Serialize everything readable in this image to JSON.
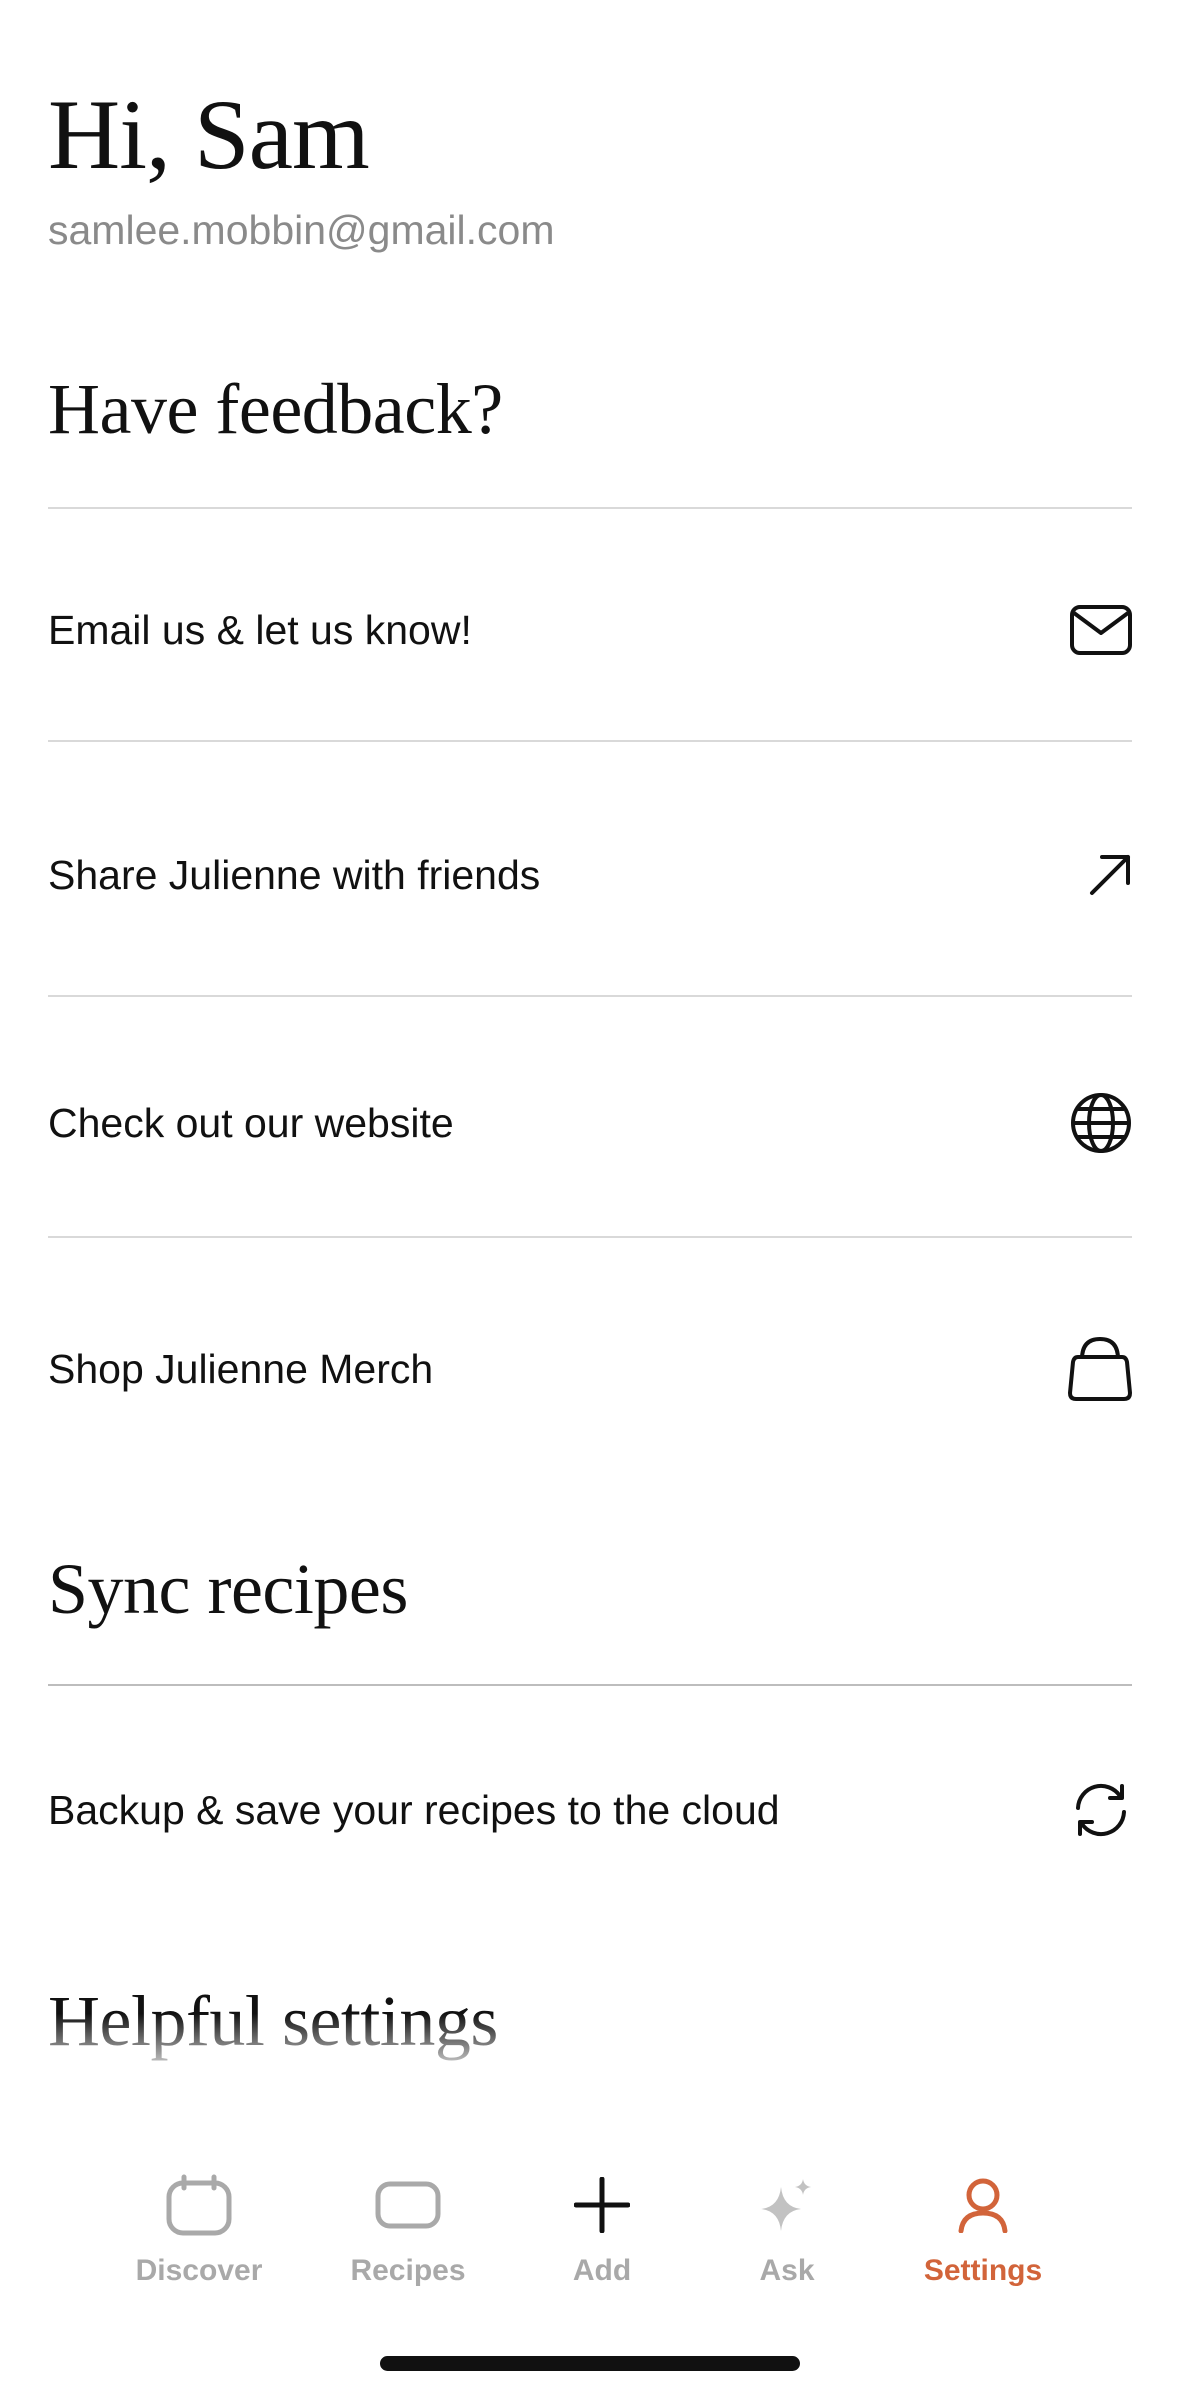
{
  "header": {
    "greeting": "Hi, Sam",
    "email": "samlee.mobbin@gmail.com"
  },
  "feedback": {
    "title": "Have feedback?",
    "items": [
      {
        "label": "Email us & let us know!",
        "icon": "mail-icon"
      },
      {
        "label": "Share Julienne with friends",
        "icon": "arrow-up-right-icon"
      },
      {
        "label": "Check out our website",
        "icon": "globe-icon"
      },
      {
        "label": "Shop Julienne Merch",
        "icon": "shopping-bag-icon"
      }
    ]
  },
  "sync": {
    "title": "Sync recipes",
    "items": [
      {
        "label": "Backup & save your recipes to the cloud",
        "icon": "sync-icon"
      }
    ]
  },
  "helpful": {
    "title": "Helpful settings"
  },
  "tabbar": {
    "active": "Settings",
    "tabs": [
      {
        "label": "Discover",
        "icon": "calendar-icon"
      },
      {
        "label": "Recipes",
        "icon": "card-icon"
      },
      {
        "label": "Add",
        "icon": "plus-icon"
      },
      {
        "label": "Ask",
        "icon": "sparkle-icon"
      },
      {
        "label": "Settings",
        "icon": "person-icon"
      }
    ]
  },
  "colors": {
    "accent": "#d2643a",
    "muted": "#a9a9a9",
    "divider": "#d9d9d9"
  }
}
